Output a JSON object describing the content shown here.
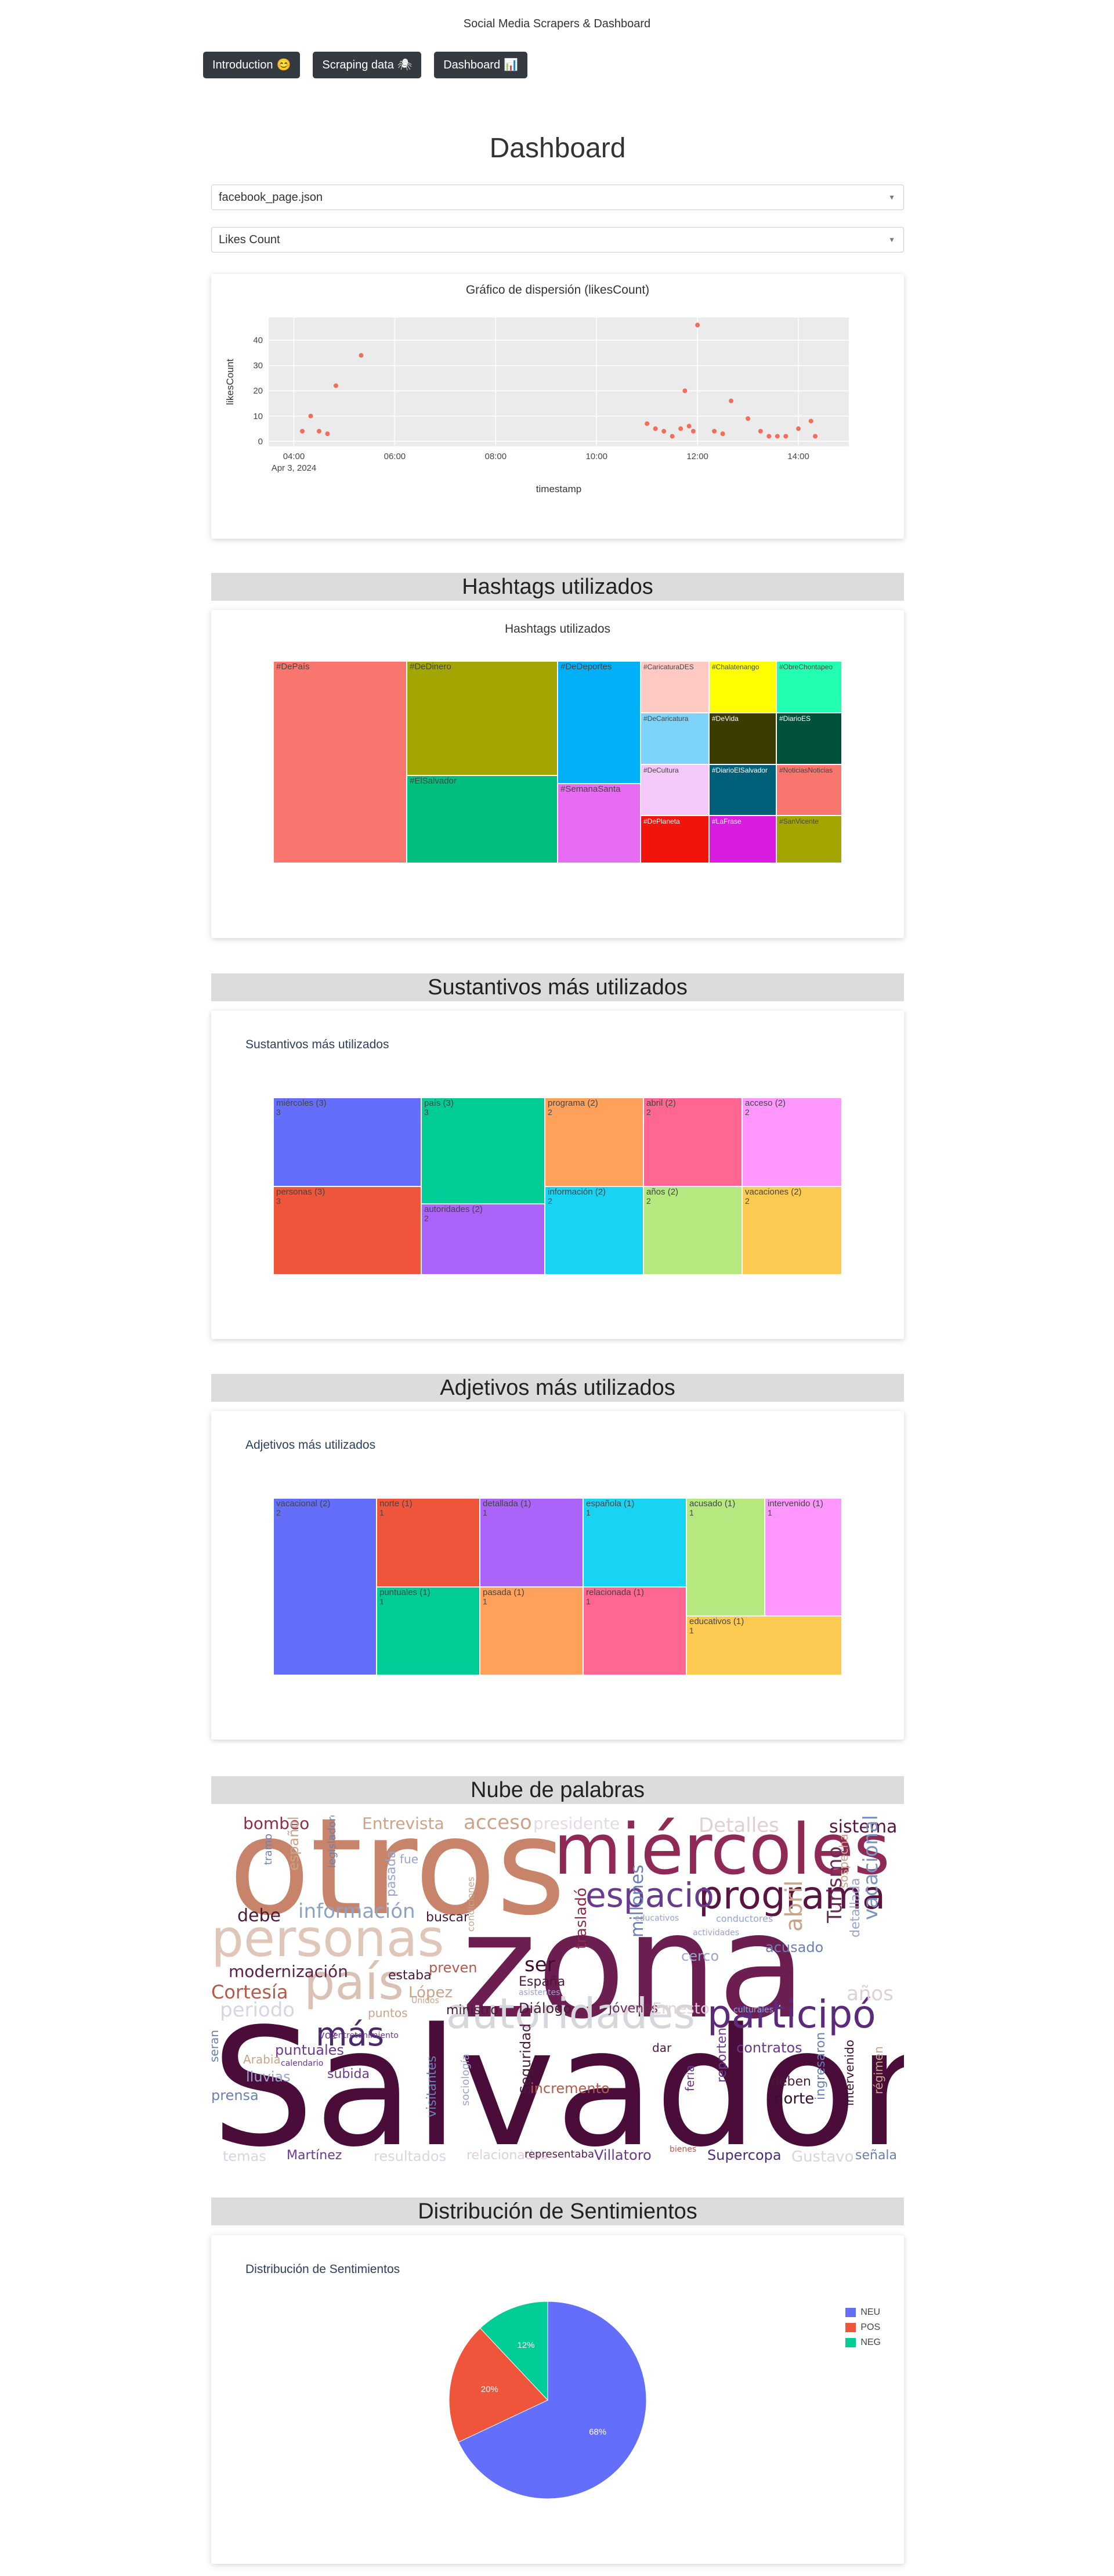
{
  "app": {
    "title": "Social Media Scrapers & Dashboard"
  },
  "nav": [
    {
      "label": "Introduction",
      "icon": "😊"
    },
    {
      "label": "Scraping data",
      "icon": "🕷"
    },
    {
      "label": "Dashboard",
      "icon": "📊"
    }
  ],
  "dashboard": {
    "title": "Dashboard",
    "file_select": {
      "value": "facebook_page.json"
    },
    "metric_select": {
      "value": "Likes Count"
    }
  },
  "scatter": {
    "title": "Gráfico de dispersión (likesCount)",
    "chart_data": {
      "type": "scatter",
      "title": "Gráfico de dispersión (likesCount)",
      "xlabel": "timestamp",
      "ylabel": "likesCount",
      "x_ticks": [
        "04:00",
        "06:00",
        "08:00",
        "10:00",
        "12:00",
        "14:00"
      ],
      "x_sub": "Apr 3, 2024",
      "y_ticks": [
        "0",
        "10",
        "20",
        "30",
        "40"
      ],
      "ylim": [
        -2,
        49
      ],
      "xlim_hours": [
        3.5,
        15.0
      ],
      "grid": true,
      "color": "#ef6f5b",
      "points": [
        {
          "x": "04:10",
          "y": 4
        },
        {
          "x": "04:20",
          "y": 10
        },
        {
          "x": "04:30",
          "y": 4
        },
        {
          "x": "04:40",
          "y": 3
        },
        {
          "x": "04:50",
          "y": 22
        },
        {
          "x": "05:20",
          "y": 34
        },
        {
          "x": "11:00",
          "y": 7
        },
        {
          "x": "11:10",
          "y": 5
        },
        {
          "x": "11:20",
          "y": 4
        },
        {
          "x": "11:30",
          "y": 2
        },
        {
          "x": "11:40",
          "y": 5
        },
        {
          "x": "11:45",
          "y": 20
        },
        {
          "x": "11:50",
          "y": 6
        },
        {
          "x": "11:55",
          "y": 4
        },
        {
          "x": "12:00",
          "y": 46
        },
        {
          "x": "12:20",
          "y": 4
        },
        {
          "x": "12:30",
          "y": 3
        },
        {
          "x": "12:40",
          "y": 16
        },
        {
          "x": "13:00",
          "y": 9
        },
        {
          "x": "13:15",
          "y": 4
        },
        {
          "x": "13:25",
          "y": 2
        },
        {
          "x": "13:35",
          "y": 2
        },
        {
          "x": "13:45",
          "y": 2
        },
        {
          "x": "14:00",
          "y": 5
        },
        {
          "x": "14:15",
          "y": 8
        },
        {
          "x": "14:20",
          "y": 2
        }
      ]
    }
  },
  "hashtags": {
    "header": "Hashtags utilizados",
    "chart_title": "Hashtags utilizados",
    "chart_data": {
      "type": "treemap",
      "tiles": [
        {
          "label": "#DePaís",
          "color": "#f8766d"
        },
        {
          "label": "#DeDinero",
          "color": "#a3a500"
        },
        {
          "label": "#ElSalvador",
          "color": "#00bf7d"
        },
        {
          "label": "#DeDeportes",
          "color": "#00b0f6"
        },
        {
          "label": "#SemanaSanta",
          "color": "#e76bf3"
        },
        {
          "label": "#CaricaturaDES",
          "color": "#ffc9c4"
        },
        {
          "label": "#Chalatenango",
          "color": "#ffff00"
        },
        {
          "label": "#ObreChontapeo",
          "color": "#23ffb0"
        },
        {
          "label": "#DeCaricatura",
          "color": "#7ed3f9"
        },
        {
          "label": "#DeVida",
          "color": "#3c3b00"
        },
        {
          "label": "#DiarioES",
          "color": "#00503a"
        },
        {
          "label": "#DeCultura",
          "color": "#f4c8f8"
        },
        {
          "label": "#DiarioElSalvador",
          "color": "#00607a"
        },
        {
          "label": "#NoticiasNoticias",
          "color": "#f8766d"
        },
        {
          "label": "#DePlaneta",
          "color": "#f0140a"
        },
        {
          "label": "#LaFrase",
          "color": "#d91ce0"
        },
        {
          "label": "#SanVicente",
          "color": "#a3a500"
        }
      ]
    }
  },
  "sustantivos": {
    "header": "Sustantivos más utilizados",
    "chart_title": "Sustantivos más utilizados",
    "chart_data": {
      "type": "treemap",
      "tiles": [
        {
          "label": "miércoles (3)",
          "value": 3,
          "color": "#636efa"
        },
        {
          "label": "personas (3)",
          "value": 3,
          "color": "#ef553b"
        },
        {
          "label": "país (3)",
          "value": 3,
          "color": "#00cc96"
        },
        {
          "label": "autoridades (2)",
          "value": 2,
          "color": "#ab63fa"
        },
        {
          "label": "programa (2)",
          "value": 2,
          "color": "#ffa15a"
        },
        {
          "label": "información (2)",
          "value": 2,
          "color": "#19d3f3"
        },
        {
          "label": "abril (2)",
          "value": 2,
          "color": "#ff6692"
        },
        {
          "label": "años (2)",
          "value": 2,
          "color": "#b6e880"
        },
        {
          "label": "acceso (2)",
          "value": 2,
          "color": "#ff97ff"
        },
        {
          "label": "vacaciones (2)",
          "value": 2,
          "color": "#fecb52"
        }
      ]
    }
  },
  "adjetivos": {
    "header": "Adjetivos más utilizados",
    "chart_title": "Adjetivos más utilizados",
    "chart_data": {
      "type": "treemap",
      "tiles": [
        {
          "label": "vacacional (2)",
          "value": 2,
          "color": "#636efa"
        },
        {
          "label": "norte (1)",
          "value": 1,
          "color": "#ef553b"
        },
        {
          "label": "puntuales (1)",
          "value": 1,
          "color": "#00cc96"
        },
        {
          "label": "detallada (1)",
          "value": 1,
          "color": "#ab63fa"
        },
        {
          "label": "pasada (1)",
          "value": 1,
          "color": "#ffa15a"
        },
        {
          "label": "española (1)",
          "value": 1,
          "color": "#19d3f3"
        },
        {
          "label": "relacionada (1)",
          "value": 1,
          "color": "#ff6692"
        },
        {
          "label": "acusado (1)",
          "value": 1,
          "color": "#b6e880"
        },
        {
          "label": "intervenido (1)",
          "value": 1,
          "color": "#ff97ff"
        },
        {
          "label": "educativos (1)",
          "value": 1,
          "color": "#fecb52"
        }
      ]
    }
  },
  "wordcloud": {
    "header": "Nube de palabras",
    "words": [
      {
        "text": "Salvador",
        "color": "#4a0d3a"
      },
      {
        "text": "zona",
        "color": "#6b1e4f"
      },
      {
        "text": "otros",
        "color": "#c8846a"
      },
      {
        "text": "miércoles",
        "color": "#8e2a55"
      },
      {
        "text": "personas",
        "color": "#e0c6b8"
      },
      {
        "text": "programa",
        "color": "#5a1440"
      },
      {
        "text": "país",
        "color": "#d9c1b6"
      },
      {
        "text": "autoridades",
        "color": "#d6d6dd"
      },
      {
        "text": "participó",
        "color": "#5c2a7a"
      },
      {
        "text": "espacio",
        "color": "#6a3a8e"
      },
      {
        "text": "más",
        "color": "#4b2a6b"
      },
      {
        "text": "información",
        "color": "#8aa3c6"
      },
      {
        "text": "Cortesía",
        "color": "#b55a4a"
      },
      {
        "text": "modernización",
        "color": "#5a2048"
      },
      {
        "text": "Ministerio",
        "color": "#c9a48a"
      },
      {
        "text": "bombeo",
        "color": "#8c2d45"
      },
      {
        "text": "Entrevista",
        "color": "#c9a48a"
      },
      {
        "text": "acceso",
        "color": "#c9a48a"
      },
      {
        "text": "presidente",
        "color": "#e3dbe4"
      },
      {
        "text": "Detalles",
        "color": "#e0d0d0"
      },
      {
        "text": "sistema",
        "color": "#5a1440"
      },
      {
        "text": "vacacional",
        "color": "#7a92c0"
      },
      {
        "text": "Turismo",
        "color": "#6a2a55"
      },
      {
        "text": "abril",
        "color": "#c9a48a"
      },
      {
        "text": "años",
        "color": "#e0d0d6"
      },
      {
        "text": "millones",
        "color": "#6a7fb5"
      },
      {
        "text": "debe",
        "color": "#4a1a3a"
      },
      {
        "text": "ser",
        "color": "#3a0d30"
      },
      {
        "text": "periodo",
        "color": "#d6d6e0"
      },
      {
        "text": "Vacaciones",
        "color": "#e0d0d0"
      },
      {
        "text": "temas",
        "color": "#d6d6e0"
      },
      {
        "text": "Martínez",
        "color": "#6a3a8e"
      },
      {
        "text": "resultados",
        "color": "#d6d6e0"
      },
      {
        "text": "relacionadas",
        "color": "#e0d0d6"
      },
      {
        "text": "representaba",
        "color": "#5a2048"
      },
      {
        "text": "Villatoro",
        "color": "#6a3a8e"
      },
      {
        "text": "Supercopa",
        "color": "#4a2a7a"
      },
      {
        "text": "Gustavo",
        "color": "#d6d6dd"
      },
      {
        "text": "señala",
        "color": "#6a7fb5"
      },
      {
        "text": "prensa",
        "color": "#6a7fb5"
      },
      {
        "text": "lluvias",
        "color": "#9aa3d0"
      },
      {
        "text": "Seguridad",
        "color": "#4a1a3a"
      },
      {
        "text": "incremento",
        "color": "#b55a4a"
      },
      {
        "text": "contratos",
        "color": "#6a3a8e"
      },
      {
        "text": "norte",
        "color": "#3a0d30"
      },
      {
        "text": "deben",
        "color": "#4a1a3a"
      },
      {
        "text": "reporten",
        "color": "#6a3a8e"
      },
      {
        "text": "ingresaron",
        "color": "#6a7fb5"
      },
      {
        "text": "intervenido",
        "color": "#3a0d30"
      },
      {
        "text": "régimen",
        "color": "#c9a48a"
      },
      {
        "text": "legisladores",
        "color": "#6a7fb5"
      },
      {
        "text": "española",
        "color": "#c9a48a"
      },
      {
        "text": "tramo",
        "color": "#6a7fb5"
      },
      {
        "text": "pasada",
        "color": "#9aa3d0"
      },
      {
        "text": "fue",
        "color": "#9aa3d0"
      },
      {
        "text": "buscar",
        "color": "#4a1a3a"
      },
      {
        "text": "preven",
        "color": "#b55a4a"
      },
      {
        "text": "estaba",
        "color": "#4a1a3a"
      },
      {
        "text": "España",
        "color": "#4a1a3a"
      },
      {
        "text": "trasladó",
        "color": "#8c2d45"
      },
      {
        "text": "cerco",
        "color": "#9aa3d0"
      },
      {
        "text": "acusado",
        "color": "#6a7fb5"
      },
      {
        "text": "sospecha",
        "color": "#c9a48a"
      },
      {
        "text": "detallada",
        "color": "#9aa3d0"
      },
      {
        "text": "ministro",
        "color": "#4a1a3a"
      },
      {
        "text": "Diálogo",
        "color": "#4a1a3a"
      },
      {
        "text": "López",
        "color": "#c9a48a"
      },
      {
        "text": "jóvenes",
        "color": "#6a2a55"
      },
      {
        "text": "Ernesto",
        "color": "#e0d0d6"
      },
      {
        "text": "puntuales",
        "color": "#6a3a8e"
      },
      {
        "text": "Arabia",
        "color": "#c9a48a"
      },
      {
        "text": "subida",
        "color": "#6a3a8e"
      },
      {
        "text": "serán",
        "color": "#6a7fb5"
      },
      {
        "text": "visitantes",
        "color": "#6a7fb5"
      },
      {
        "text": "dar",
        "color": "#4a1a3a"
      },
      {
        "text": "conductores",
        "color": "#9aa3d0"
      },
      {
        "text": "actividades",
        "color": "#9aa3d0"
      },
      {
        "text": "culturales",
        "color": "#9aa3d0"
      },
      {
        "text": "educativos",
        "color": "#9aa3d0"
      },
      {
        "text": "asistentes",
        "color": "#9aa3d0"
      },
      {
        "text": "condiciones",
        "color": "#c9a48a"
      },
      {
        "text": "puntos",
        "color": "#c9a48a"
      },
      {
        "text": "calendario",
        "color": "#6a3a8e"
      },
      {
        "text": "entretenimiento",
        "color": "#6a3a8e"
      },
      {
        "text": "voz",
        "color": "#6a3a8e"
      },
      {
        "text": "feria",
        "color": "#6a3a8e"
      },
      {
        "text": "Unidos",
        "color": "#c9a48a"
      },
      {
        "text": "bienes",
        "color": "#b55a4a"
      },
      {
        "text": "sociología",
        "color": "#9aa3d0"
      }
    ]
  },
  "sentimientos": {
    "header": "Distribución de Sentimientos",
    "chart_title": "Distribución de Sentimientos",
    "chart_data": {
      "type": "pie",
      "slices": [
        {
          "label": "NEU",
          "value": 68,
          "text": "68%",
          "color": "#636efa"
        },
        {
          "label": "POS",
          "value": 20,
          "text": "20%",
          "color": "#ef553b"
        },
        {
          "label": "NEG",
          "value": 12,
          "text": "12%",
          "color": "#00cc96"
        }
      ]
    }
  }
}
